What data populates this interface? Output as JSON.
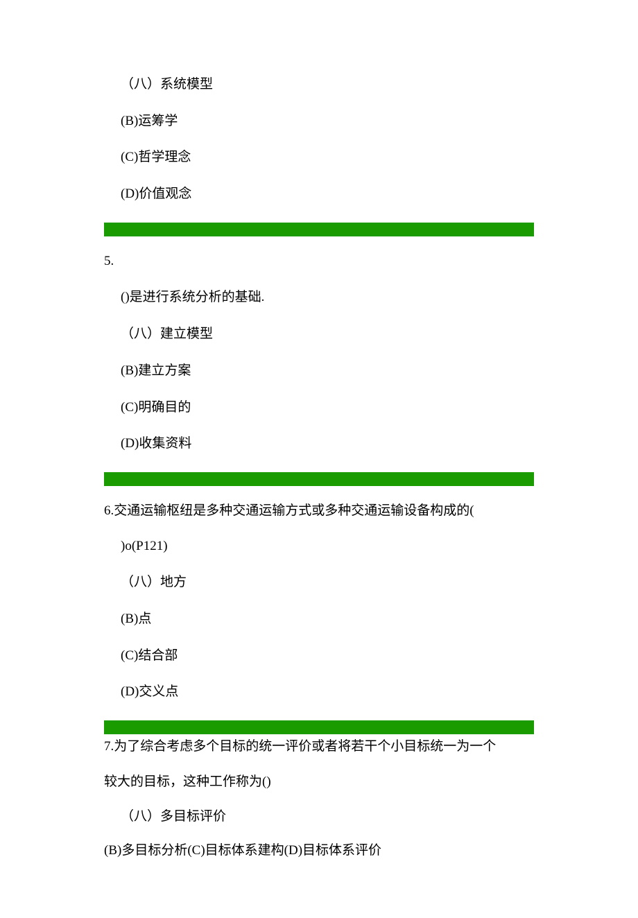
{
  "q4": {
    "optA": "（八）系统模型",
    "optB": "(B)运筹学",
    "optC": "(C)哲学理念",
    "optD": "(D)价值观念"
  },
  "q5": {
    "num": "5.",
    "stem": "()是进行系统分析的基础.",
    "optA": "（八）建立模型",
    "optB": "(B)建立方案",
    "optC": "(C)明确目的",
    "optD": "(D)收集资料"
  },
  "q6": {
    "line1": "6.交通运输枢纽是多种交通运输方式或多种交通运输设备构成的(",
    "line2": ")o(P121)",
    "optA": "（八）地方",
    "optB": "(B)点",
    "optC": "(C)结合部",
    "optD": "(D)交义点"
  },
  "q7": {
    "line1": "7.为了综合考虑多个目标的统一评价或者将若干个小目标统一为一个",
    "line2": "较大的目标，这种工作称为()",
    "optA": "（八）多目标评价",
    "optsBCD": "(B)多目标分析(C)目标体系建构(D)目标体系评价"
  }
}
